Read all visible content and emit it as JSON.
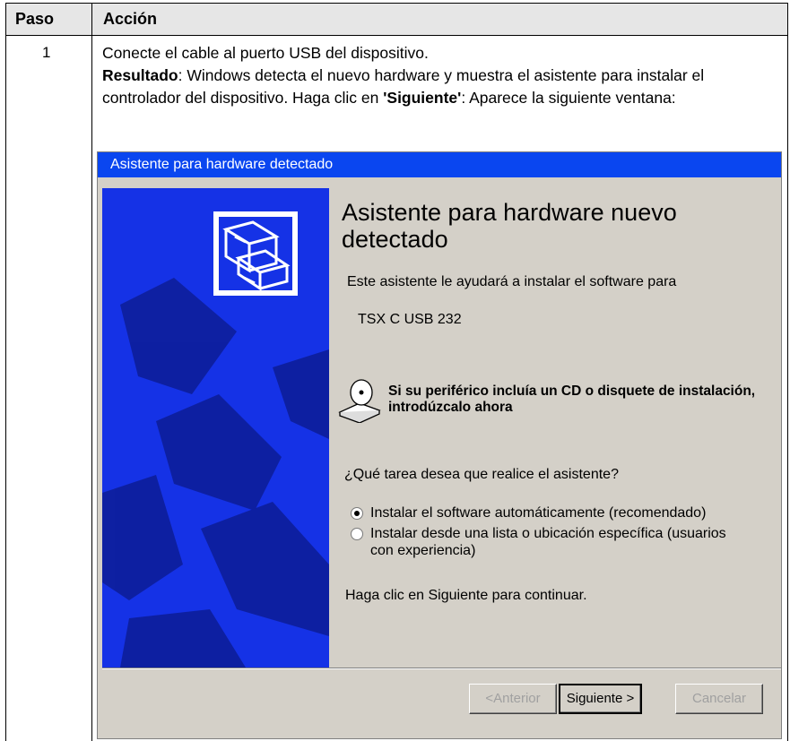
{
  "table": {
    "col_paso": "Paso",
    "col_accion": "Acción",
    "step_number": "1",
    "line1": "Conecte el cable al puerto USB del dispositivo.",
    "result_label": "Resultado",
    "result_text": ": Windows detecta el nuevo hardware y muestra el asistente para instalar el controlador del dispositivo. Haga clic en ",
    "result_next": "'Siguiente'",
    "result_tail": ": Aparece la siguiente ventana:"
  },
  "dialog": {
    "title": "Asistente para hardware detectado",
    "heading": "Asistente para hardware nuevo detectado",
    "intro": "Este asistente le ayudará a instalar el software para",
    "device": "TSX C USB 232",
    "cd_note": "Si su periférico incluía un CD o disquete de instalación, introdúzcalo ahora",
    "question": "¿Qué tarea desea que realice el asistente?",
    "option_auto": "Instalar el software automáticamente (recomendado)",
    "option_manual": "Instalar desde una lista o ubicación específica (usuarios con experiencia)",
    "option_selected": "option_auto",
    "continue_note": "Haga clic en Siguiente para continuar.",
    "btn_prev": "<Anterior",
    "btn_next": "Siguiente >",
    "btn_cancel": "Cancelar"
  },
  "colors": {
    "titlebar": "#0a46f0",
    "side_panel": "#1532e6",
    "dialog_bg": "#d4d0c8",
    "header_bg": "#e6e6e6"
  },
  "icons": [
    "hardware-wizard-icon",
    "cd-drive-icon"
  ]
}
